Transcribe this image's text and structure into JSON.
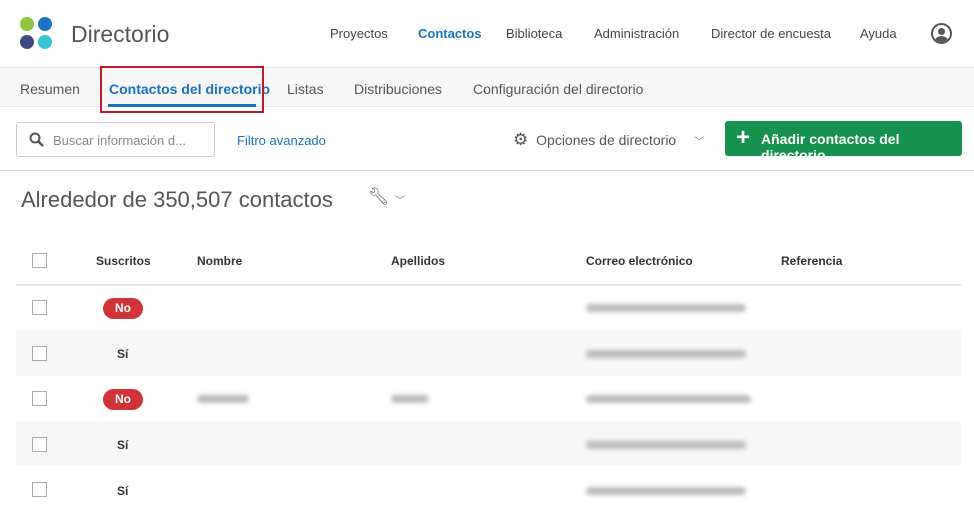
{
  "app": {
    "title": "Directorio",
    "logo_colors": [
      "#8dc63f",
      "#1a73c1",
      "#3e4b7d",
      "#36c5d0"
    ]
  },
  "nav": [
    "Proyectos",
    "Contactos",
    "Biblioteca",
    "Administración",
    "Director de encuesta",
    "Ayuda"
  ],
  "tabs": [
    "Resumen",
    "Contactos del directorio",
    "Listas",
    "Distribuciones",
    "Configuración del directorio"
  ],
  "toolbar": {
    "search_placeholder": "Buscar información d...",
    "advanced": "Filtro avanzado",
    "options": "Opciones de directorio",
    "add": "Añadir contactos del directorio"
  },
  "count": "Alrededor de 350,507 contactos",
  "columns": [
    "Suscritos",
    "Nombre",
    "Apellidos",
    "Correo electrónico",
    "Referencia"
  ],
  "rows": [
    {
      "subscribed": "No"
    },
    {
      "subscribed": "Sí"
    },
    {
      "subscribed": "No"
    },
    {
      "subscribed": "Sí"
    },
    {
      "subscribed": "Sí"
    }
  ]
}
